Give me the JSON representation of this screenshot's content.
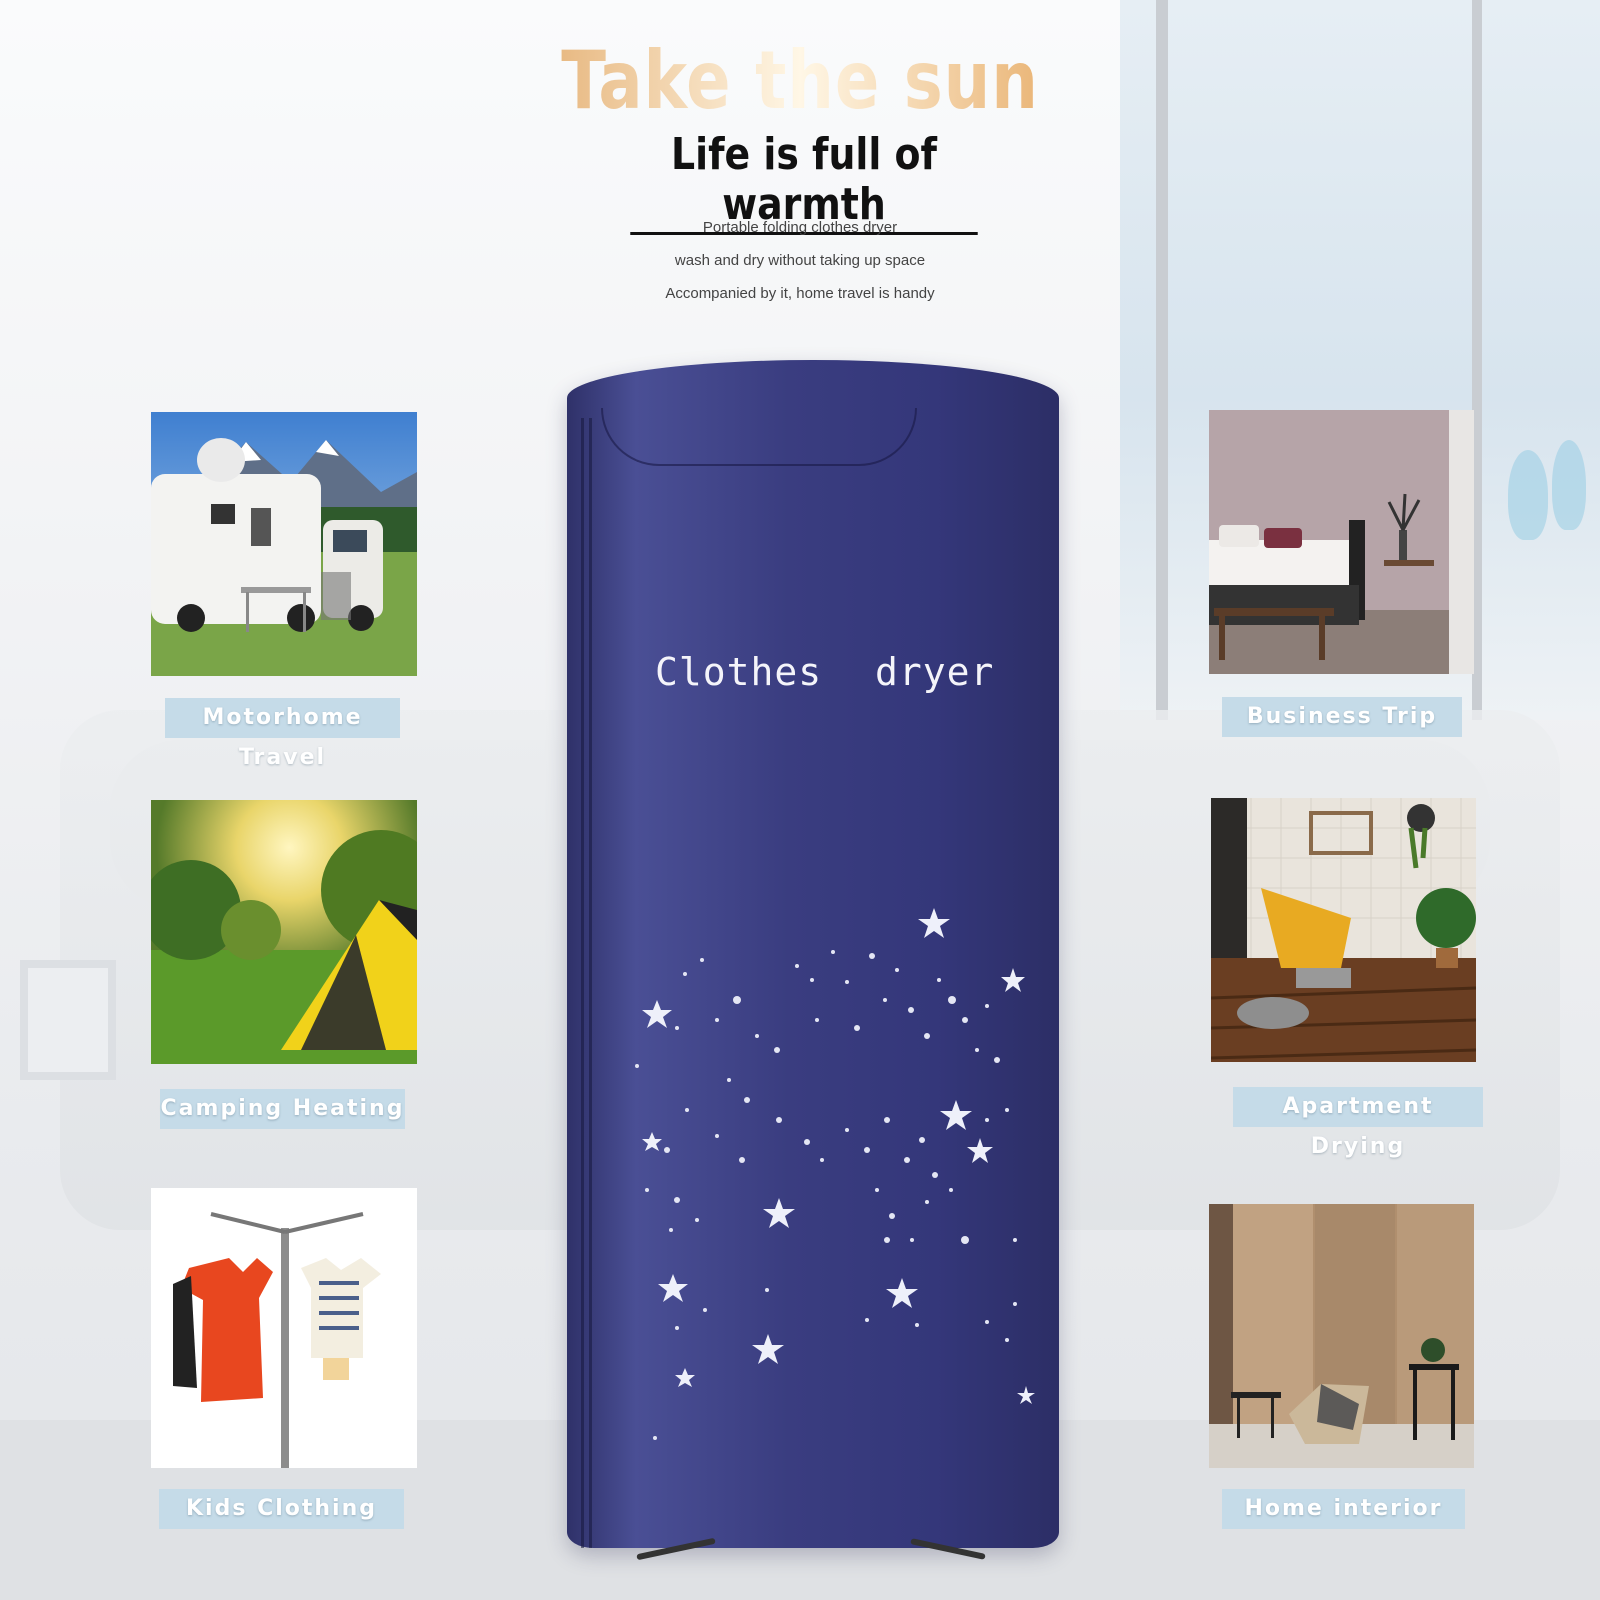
{
  "headline": "Take the sun",
  "subhead": "Life is full of warmth",
  "taglines": [
    "Portable folding clothes dryer",
    "wash and dry without taking up space",
    "Accompanied by it, home travel is handy"
  ],
  "product": {
    "label_word1": "Clothes",
    "label_word2": "dryer",
    "color": "#3a3d80"
  },
  "scenarios": {
    "motorhome": "Motorhome Travel",
    "camping": "Camping Heating",
    "kids": "Kids Clothing",
    "business": "Business Trip",
    "apartment": "Apartment Drying",
    "home": "Home interior"
  },
  "colors": {
    "accent_gold": "#e6b47a",
    "label_bg": "#c5dbe8"
  }
}
